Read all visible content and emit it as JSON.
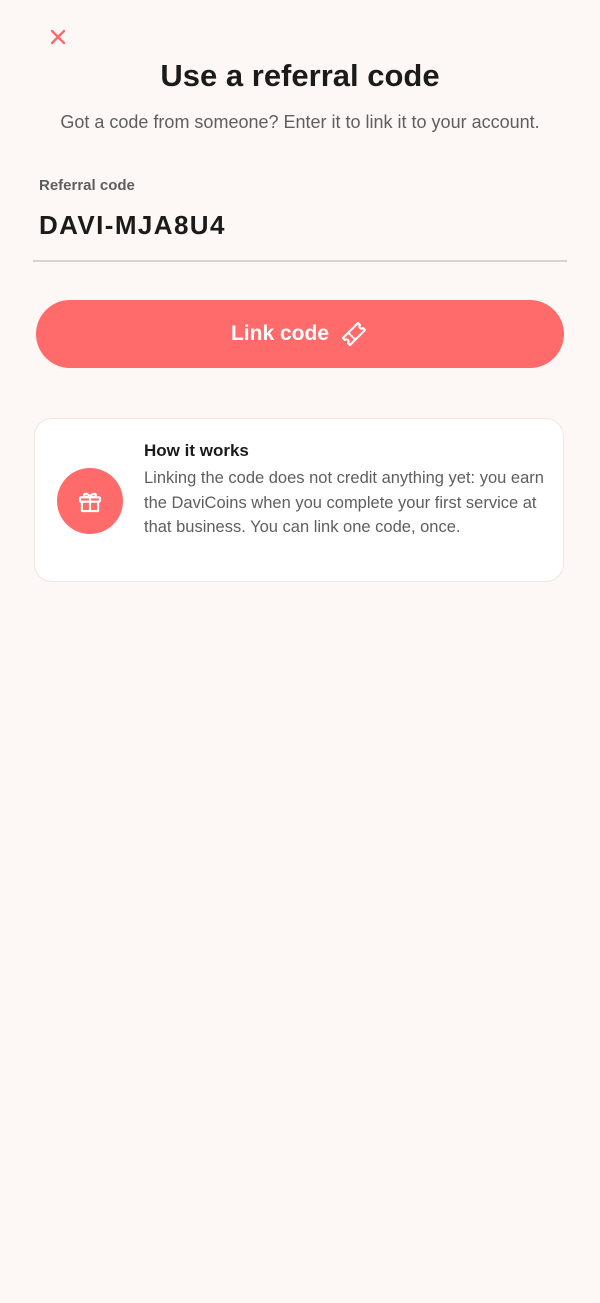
{
  "header": {
    "close_icon": "close-icon",
    "title": "Use a referral code",
    "subtitle": "Got a code from someone? Enter it to link it to your account."
  },
  "form": {
    "label": "Referral code",
    "value": "DAVI-MJA8U4"
  },
  "button": {
    "label": "Link code",
    "icon": "ticket-icon"
  },
  "info": {
    "icon": "gift-icon",
    "title": "How it works",
    "body": "Linking the code does not credit anything yet: you earn the DaviCoins when you complete your first service at that business. You can link one code, once."
  },
  "colors": {
    "accent": "#ff6b6b",
    "background": "#fdf8f6",
    "text": "#1c1b1b",
    "muted": "#5f5e5e"
  }
}
